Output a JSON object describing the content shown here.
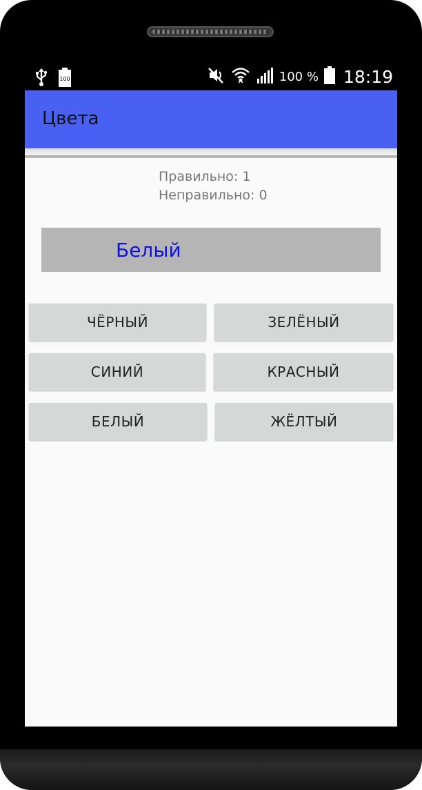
{
  "status_bar": {
    "icons_left": [
      "usb-icon",
      "battery-full-icon"
    ],
    "battery_label": "100",
    "icons_right": [
      "mute-icon",
      "wifi-icon",
      "signal-icon",
      "battery-icon"
    ],
    "battery_percent": "100 %",
    "clock": "18:19"
  },
  "app_bar": {
    "title": "Цвета"
  },
  "score": {
    "correct": "Правильно: 1",
    "incorrect": "Неправильно: 0"
  },
  "color_display": {
    "word": "Белый",
    "word_color": "#1111dd",
    "background": "#b5b5b5"
  },
  "answers": {
    "black": "ЧЁРНЫЙ",
    "green": "ЗЕЛЁНЫЙ",
    "blue": "СИНИЙ",
    "red": "КРАСНЫЙ",
    "white": "БЕЛЫЙ",
    "yellow": "ЖЁЛТЫЙ"
  },
  "colors": {
    "accent": "#4961f2",
    "button": "#d6d7d7",
    "screen_bg": "#fafafa"
  }
}
